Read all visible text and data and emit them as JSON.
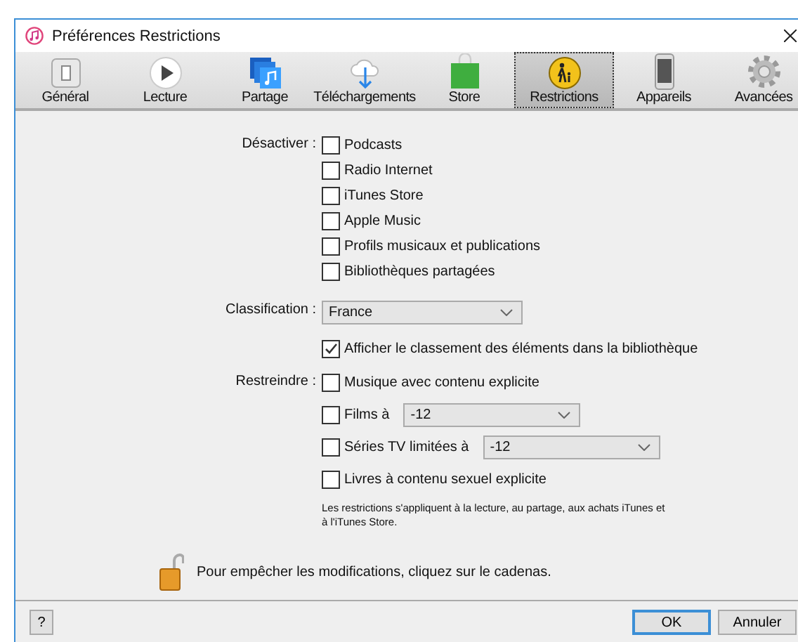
{
  "window": {
    "title": "Préférences Restrictions"
  },
  "tabs": [
    {
      "label": "Général",
      "kind": "switch",
      "selected": false
    },
    {
      "label": "Lecture",
      "kind": "play",
      "selected": false
    },
    {
      "label": "Partage",
      "kind": "share",
      "selected": false
    },
    {
      "label": "Téléchargements",
      "kind": "download",
      "selected": false
    },
    {
      "label": "Store",
      "kind": "bag",
      "selected": false
    },
    {
      "label": "Restrictions",
      "kind": "parental",
      "selected": true
    },
    {
      "label": "Appareils",
      "kind": "phone",
      "selected": false
    },
    {
      "label": "Avancées",
      "kind": "gear",
      "selected": false
    }
  ],
  "disable": {
    "label": "Désactiver :",
    "options": [
      {
        "label": "Podcasts",
        "checked": false
      },
      {
        "label": "Radio Internet",
        "checked": false
      },
      {
        "label": "iTunes Store",
        "checked": false
      },
      {
        "label": "Apple Music",
        "checked": false
      },
      {
        "label": "Profils musicaux et publications",
        "checked": false
      },
      {
        "label": "Bibliothèques partagées",
        "checked": false
      }
    ]
  },
  "classification": {
    "label": "Classification :",
    "value": "France"
  },
  "show_ratings": {
    "label": "Afficher le classement des éléments dans la bibliothèque",
    "checked": true
  },
  "restrict": {
    "label": "Restreindre :",
    "options": [
      {
        "kind": "checkbox",
        "label": "Musique avec contenu explicite",
        "checked": false
      },
      {
        "kind": "select",
        "label": "Films à",
        "checked": false,
        "value": "-12"
      },
      {
        "kind": "select",
        "label": "Séries TV limitées à",
        "checked": false,
        "value": "-12"
      },
      {
        "kind": "checkbox",
        "label": "Livres à contenu sexuel explicite",
        "checked": false
      }
    ]
  },
  "note": "Les restrictions s'appliquent à la lecture, au partage, aux achats iTunes et à l'iTunes Store.",
  "lock_message": "Pour empêcher les modifications, cliquez sur le cadenas.",
  "help_button": "?",
  "buttons": [
    {
      "label": "OK",
      "default": true
    },
    {
      "label": "Annuler",
      "default": false
    }
  ]
}
